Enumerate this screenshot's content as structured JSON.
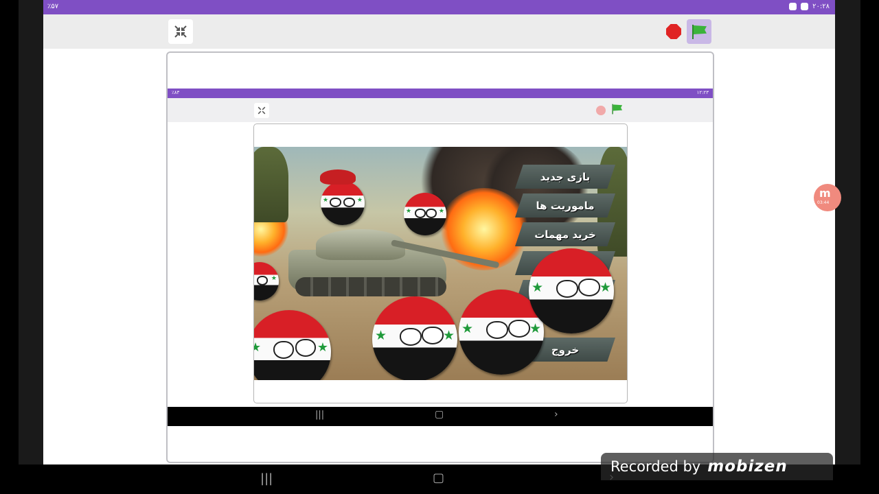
{
  "outer": {
    "status_left": "٪۵۷",
    "status_time": "۲۰:۲۸"
  },
  "inner": {
    "status_left": "٪۸۳",
    "status_time": "۱۲:۲۳"
  },
  "game": {
    "menu": [
      {
        "label": "بازی جدید"
      },
      {
        "label": "ماموریت ها"
      },
      {
        "label": "خرید مهمات"
      },
      {
        "label": ""
      },
      {
        "label": ""
      },
      {
        "label": "خروج"
      }
    ]
  },
  "recorder": {
    "watermark_prefix": "Recorded by",
    "watermark_brand": "mobizen",
    "floating_time": "03:44"
  },
  "colors": {
    "status_bar": "#7f4fc4",
    "stop": "#e02424",
    "flag": "#3bb33b"
  },
  "icons": {
    "fullscreen_exit": "fullscreen-exit-icon",
    "stop": "stop-icon",
    "green_flag": "green-flag-icon"
  }
}
